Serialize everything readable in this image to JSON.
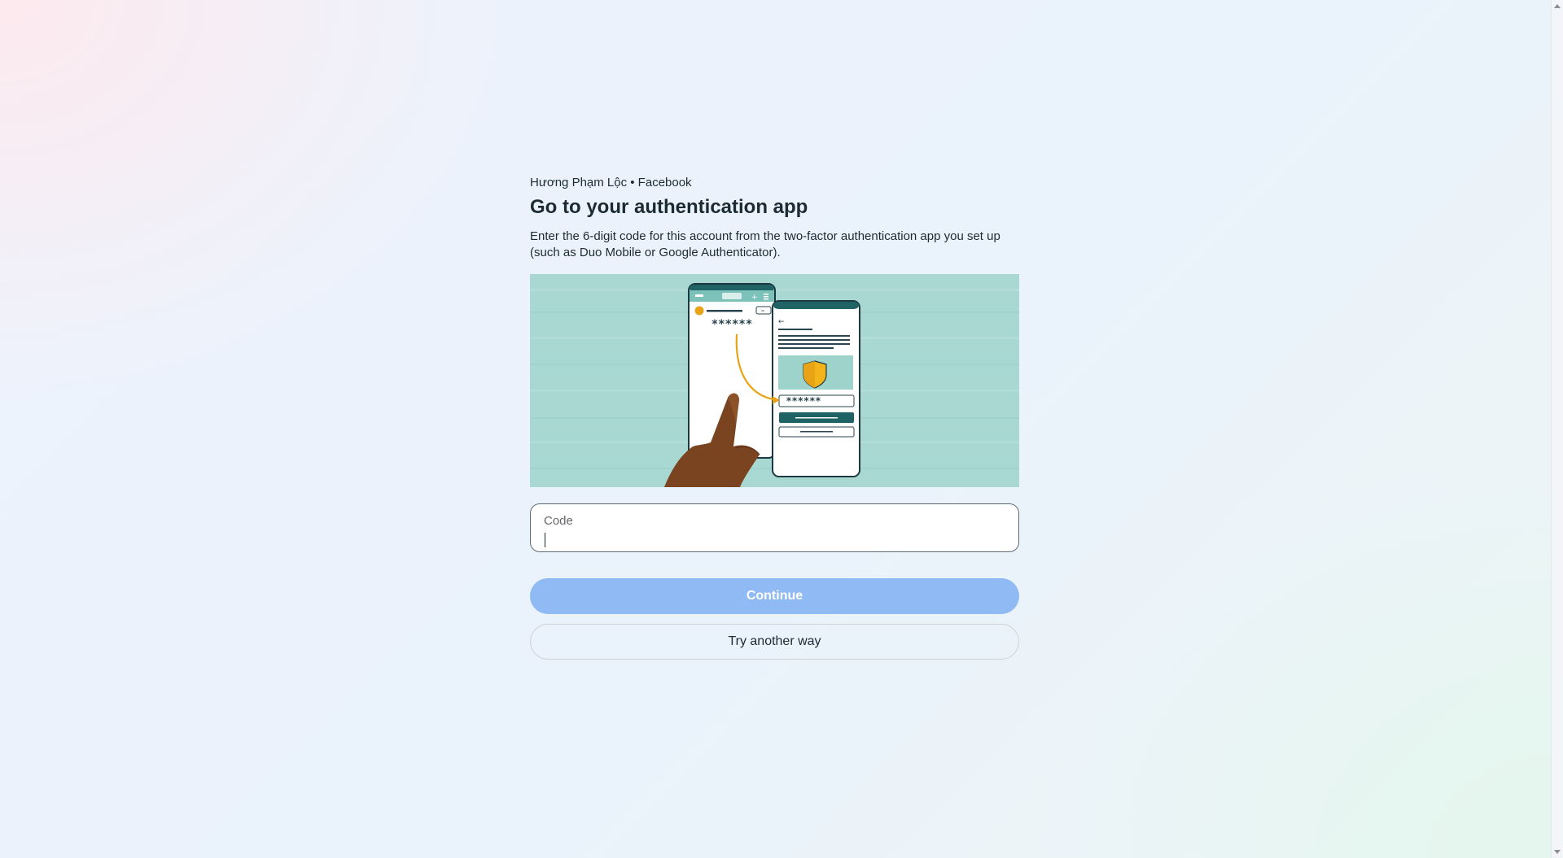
{
  "header": {
    "account_line": "Hương Phạm Lộc • Facebook",
    "title": "Go to your authentication app",
    "description": "Enter the 6-digit code for this account from the two-factor authentication app you set up (such as Duo Mobile or Google Authenticator)."
  },
  "illustration": {
    "code_mask_left": "******",
    "code_mask_right": "******"
  },
  "form": {
    "code_label": "Code",
    "code_value": ""
  },
  "actions": {
    "continue_label": "Continue",
    "try_another_label": "Try another way"
  },
  "colors": {
    "primary_disabled": "#8fbaf3",
    "illustration_bg": "#a9d8d2",
    "accent_teal": "#1f6364",
    "accent_gold": "#e8a317"
  }
}
